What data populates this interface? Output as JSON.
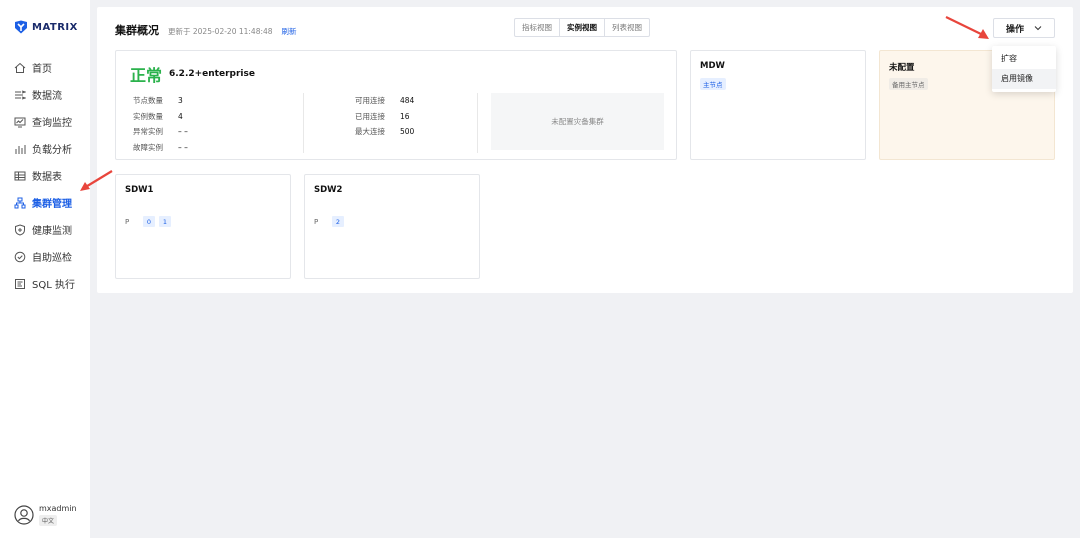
{
  "app": {
    "logo_text": "MATRIX"
  },
  "sidebar": {
    "items": [
      {
        "label": "首页",
        "icon": "home-icon"
      },
      {
        "label": "数据流",
        "icon": "dataflow-icon"
      },
      {
        "label": "查询监控",
        "icon": "monitor-icon"
      },
      {
        "label": "负载分析",
        "icon": "bar-chart-icon"
      },
      {
        "label": "数据表",
        "icon": "table-icon"
      },
      {
        "label": "集群管理",
        "icon": "cluster-icon",
        "active": true
      },
      {
        "label": "健康监测",
        "icon": "shield-icon"
      },
      {
        "label": "自助巡检",
        "icon": "check-circle-icon"
      },
      {
        "label": "SQL 执行",
        "icon": "sql-icon"
      }
    ]
  },
  "user": {
    "name": "mxadmin",
    "lang": "中文"
  },
  "header": {
    "title": "集群概况",
    "updated": "更新于 2025-02-20 11:48:48",
    "refresh": "刷新"
  },
  "views": {
    "tabs": [
      "指标视图",
      "实例视图",
      "列表视图"
    ],
    "active_index": 1
  },
  "operations": {
    "button_label": "操作",
    "menu": [
      "扩容",
      "启用镜像"
    ],
    "hover_index": 1
  },
  "summary": {
    "status": "正常",
    "version": "6.2.2+enterprise",
    "left_stats": [
      {
        "label": "节点数量",
        "value": "3"
      },
      {
        "label": "实例数量",
        "value": "4"
      },
      {
        "label": "异常实例",
        "value": "– –"
      },
      {
        "label": "故障实例",
        "value": "– –"
      }
    ],
    "right_stats": [
      {
        "label": "可用连接",
        "value": "484"
      },
      {
        "label": "已用连接",
        "value": "16"
      },
      {
        "label": "最大连接",
        "value": "500"
      }
    ],
    "standby_text": "未配置灾备集群"
  },
  "nodes": {
    "mdw": {
      "title": "MDW",
      "tag": "主节点"
    },
    "unconfigured": {
      "title": "未配置",
      "tag": "备用主节点"
    },
    "sdw1": {
      "title": "SDW1",
      "role": "P",
      "segments": [
        "0",
        "1"
      ]
    },
    "sdw2": {
      "title": "SDW2",
      "role": "P",
      "segments": [
        "2"
      ]
    }
  },
  "colors": {
    "accent": "#1c5fe5",
    "status_ok": "#2bb24c",
    "annotation_arrow": "#e8453c",
    "unconfigured_bg": "#fdf6ec"
  }
}
